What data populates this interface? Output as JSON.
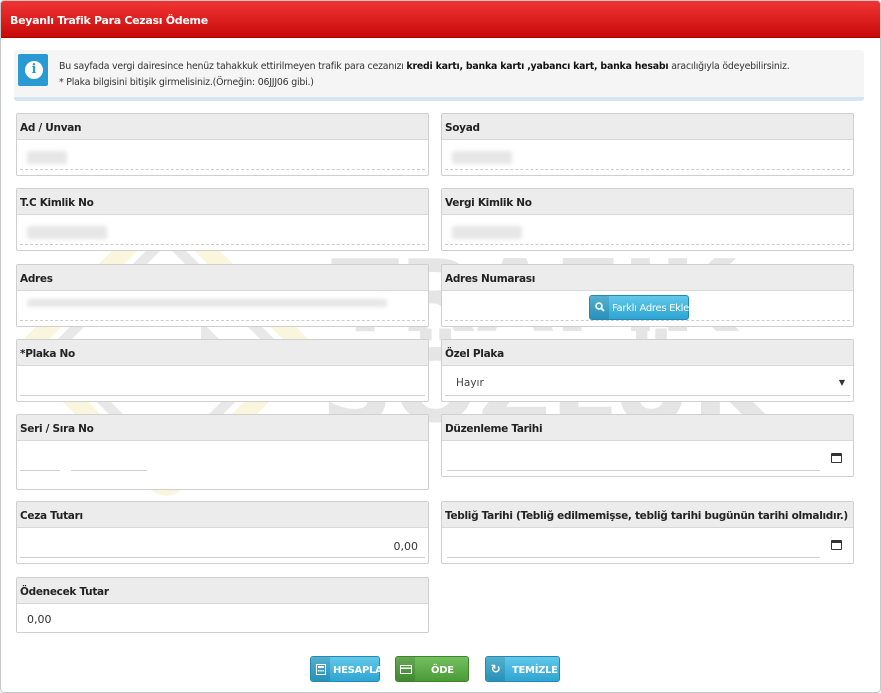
{
  "header": {
    "title": "Beyanlı Trafik Para Cezası Ödeme"
  },
  "info": {
    "icon": "info-icon",
    "line1_prefix": "Bu sayfada vergi dairesince henüz tahakkuk ettirilmeyen trafik para cezanızı ",
    "line1_bold1": "kredi kartı, banka kartı ,yabancı kart, banka hesabı",
    "line1_suffix": " aracılığıyla ödeyebilirsiniz.",
    "line2": "* Plaka bilgisini bitişik girmelisiniz.(Örneğin: 06JJJ06 gibi.)"
  },
  "fields": {
    "ad_unvan": {
      "label": "Ad / Unvan"
    },
    "soyad": {
      "label": "Soyad"
    },
    "tc_kimlik": {
      "label": "T.C Kimlik No"
    },
    "vergi_kimlik": {
      "label": "Vergi Kimlik No"
    },
    "adres": {
      "label": "Adres"
    },
    "adres_numarasi": {
      "label": "Adres Numarası",
      "button_label": "Farklı Adres Ekle"
    },
    "plaka_no": {
      "label": "*Plaka No"
    },
    "ozel_plaka": {
      "label": "Özel Plaka",
      "selected": "Hayır"
    },
    "seri_sira": {
      "label": "Seri / Sıra No"
    },
    "duzenleme_tarihi": {
      "label": "Düzenleme Tarihi"
    },
    "ceza_tutari": {
      "label": "Ceza Tutarı",
      "value": "0,00"
    },
    "teblig_tarihi": {
      "label": "Tebliğ Tarihi (Tebliğ edilmemişse, tebliğ tarihi bugünün tarihi olmalıdır.)"
    },
    "odenecek_tutar": {
      "label": "Ödenecek Tutar",
      "value": "0,00"
    }
  },
  "buttons": {
    "hesapla": "HESAPLA",
    "ode": "ÖDE",
    "temizle": "TEMİZLE"
  },
  "watermark": {
    "line1": "TRAFİK",
    "line2": "SÖZLÜK"
  },
  "colors": {
    "header": "#d91b1b",
    "info_icon": "#2a9bd2",
    "button_blue": "#3fb4dd",
    "button_green": "#5aab46"
  }
}
